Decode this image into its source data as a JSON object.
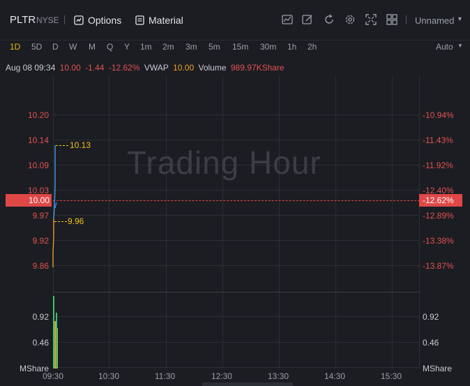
{
  "header": {
    "ticker": "PLTR",
    "exchange": "NYSE",
    "options_label": "Options",
    "material_label": "Material",
    "layout_name": "Unnamed"
  },
  "periods": [
    "1D",
    "5D",
    "D",
    "W",
    "M",
    "Q",
    "Y",
    "1m",
    "2m",
    "3m",
    "5m",
    "15m",
    "30m",
    "1h",
    "2h"
  ],
  "active_period": "1D",
  "scale_mode": "Auto",
  "info": {
    "datetime": "Aug 08 09:34",
    "price": "10.00",
    "change": "-1.44",
    "change_pct": "-12.62%",
    "vwap_label": "VWAP",
    "vwap_value": "10.00",
    "volume_label": "Volume",
    "volume_value": "989.97KShare"
  },
  "chart": {
    "watermark": "Trading Hour",
    "price_ticks": [
      "10.20",
      "10.14",
      "10.09",
      "10.03",
      "9.97",
      "9.92",
      "9.86"
    ],
    "pct_ticks": [
      "-10.94%",
      "-11.43%",
      "-11.92%",
      "-12.40%",
      "-12.89%",
      "-13.38%",
      "-13.87%"
    ],
    "current_price": "10.00",
    "current_pct": "-12.62%",
    "high_annotation": "10.13",
    "low_annotation": "9.96",
    "volume_ticks": [
      "0.92",
      "0.46"
    ],
    "volume_unit": "MShare",
    "time_labels": [
      "09:30",
      "10:30",
      "11:30",
      "12:30",
      "13:30",
      "14:30",
      "15:30"
    ],
    "colors": {
      "up": "#4aa3ff",
      "down": "#f0a030",
      "negative": "#e05252",
      "annotation": "#f0c419",
      "volume_green": "#3fbf6f",
      "volume_orange": "#c9a33a"
    }
  },
  "icons": [
    "options-icon",
    "material-icon",
    "indicator-icon",
    "draw-icon",
    "refresh-icon",
    "settings-icon",
    "fullscreen-icon",
    "layout-grid-icon",
    "chevron-down-icon"
  ]
}
